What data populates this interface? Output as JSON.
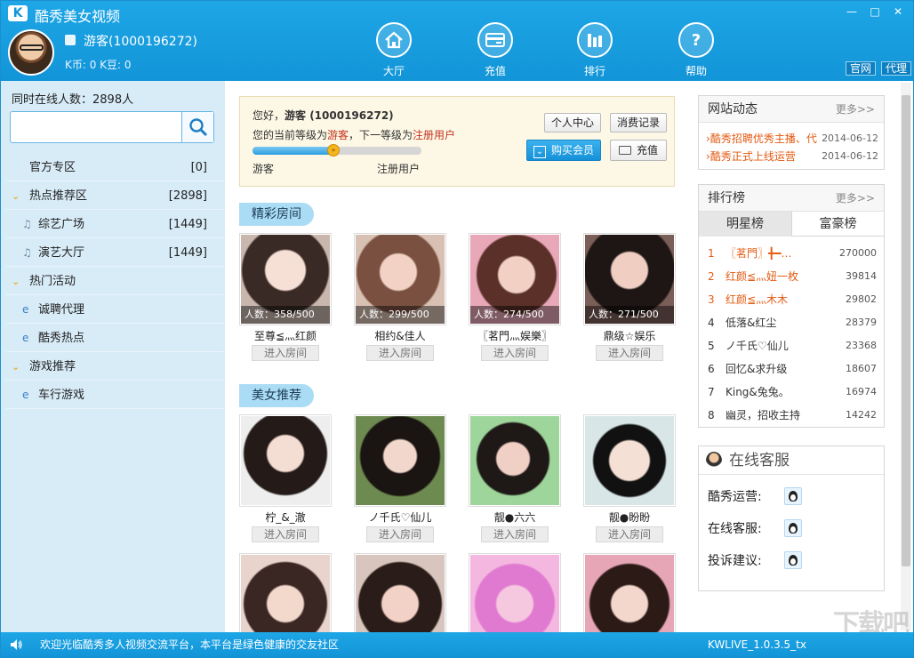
{
  "window": {
    "title": "酷秀美女视频",
    "logo": "K"
  },
  "user": {
    "name": "游客(1000196272)",
    "coins": "K币: 0  K豆: 0"
  },
  "nav": [
    {
      "label": "大厅",
      "icon": "home-icon"
    },
    {
      "label": "充值",
      "icon": "card-icon"
    },
    {
      "label": "排行",
      "icon": "bars-icon"
    },
    {
      "label": "帮助",
      "icon": "help-icon"
    }
  ],
  "toplinks": {
    "official": "官网",
    "agent": "代理"
  },
  "sidebar": {
    "online": "同时在线人数：2898人",
    "search_placeholder": "",
    "items": [
      {
        "label": "官方专区",
        "count": "[0]"
      },
      {
        "label": "热点推荐区",
        "count": "[2898]"
      },
      {
        "label": "综艺广场",
        "count": "[1449]"
      },
      {
        "label": "演艺大厅",
        "count": "[1449]"
      },
      {
        "label": "热门活动",
        "count": ""
      },
      {
        "label": "诚聘代理",
        "count": ""
      },
      {
        "label": "酷秀热点",
        "count": ""
      },
      {
        "label": "游戏推荐",
        "count": ""
      },
      {
        "label": "车行游戏",
        "count": ""
      }
    ]
  },
  "userpanel": {
    "hello_prefix": "您好，",
    "hello_name": "游客 (1000196272)",
    "level_1": "您的当前等级为",
    "level_cur": "游客",
    "level_2": "，下一等级为",
    "level_next": "注册用户",
    "progress": 0.5,
    "from": "游客",
    "to": "注册用户",
    "btn_center": "个人中心",
    "btn_records": "消费记录",
    "btn_buy": "购买会员",
    "btn_recharge": "充值"
  },
  "sections": {
    "featured": "精彩房间",
    "beauty": "美女推荐"
  },
  "enter_label": "进入房间",
  "featured_rooms": [
    {
      "name": "至尊≦灬红颜",
      "count": "人数：358/500"
    },
    {
      "name": "相约&佳人",
      "count": "人数：299/500"
    },
    {
      "name": "〖茗門灬娱樂〗",
      "count": "人数：274/500"
    },
    {
      "name": "鼎级☆娱乐",
      "count": "人数：271/500"
    }
  ],
  "beauty_rooms": [
    {
      "name": "柠_&_澈"
    },
    {
      "name": "ノ千氏♡仙儿"
    },
    {
      "name": "靓●六六"
    },
    {
      "name": "靓●盼盼"
    }
  ],
  "news": {
    "title": "网站动态",
    "more": "更多>>",
    "items": [
      {
        "text": "酷秀招聘优秀主播、代",
        "date": "2014-06-12"
      },
      {
        "text": "酷秀正式上线运营",
        "date": "2014-06-12"
      }
    ]
  },
  "rank": {
    "title": "排行榜",
    "more": "更多>>",
    "tabs": [
      "明星榜",
      "富豪榜"
    ],
    "rows": [
      {
        "n": "1",
        "name": "〖茗門〗╋━…",
        "value": "270000"
      },
      {
        "n": "2",
        "name": "红颜≦灬妞一枚",
        "value": "39814"
      },
      {
        "n": "3",
        "name": "红颜≦灬木木",
        "value": "29802"
      },
      {
        "n": "4",
        "name": "低落&红尘",
        "value": "28379"
      },
      {
        "n": "5",
        "name": "ノ千氏♡仙儿",
        "value": "23368"
      },
      {
        "n": "6",
        "name": "回忆&求升级",
        "value": "18607"
      },
      {
        "n": "7",
        "name": "King&兔兔。",
        "value": "16974"
      },
      {
        "n": "8",
        "name": "幽灵，招收主持",
        "value": "14242"
      }
    ]
  },
  "service": {
    "title": "在线客服",
    "items": [
      "酷秀运营:",
      "在线客服:",
      "投诉建议:"
    ]
  },
  "status": {
    "text": "欢迎光临酷秀多人视频交流平台，本平台是绿色健康的交友社区",
    "version": "KWLIVE_1.0.3.5_tx"
  },
  "watermark": "下载吧"
}
